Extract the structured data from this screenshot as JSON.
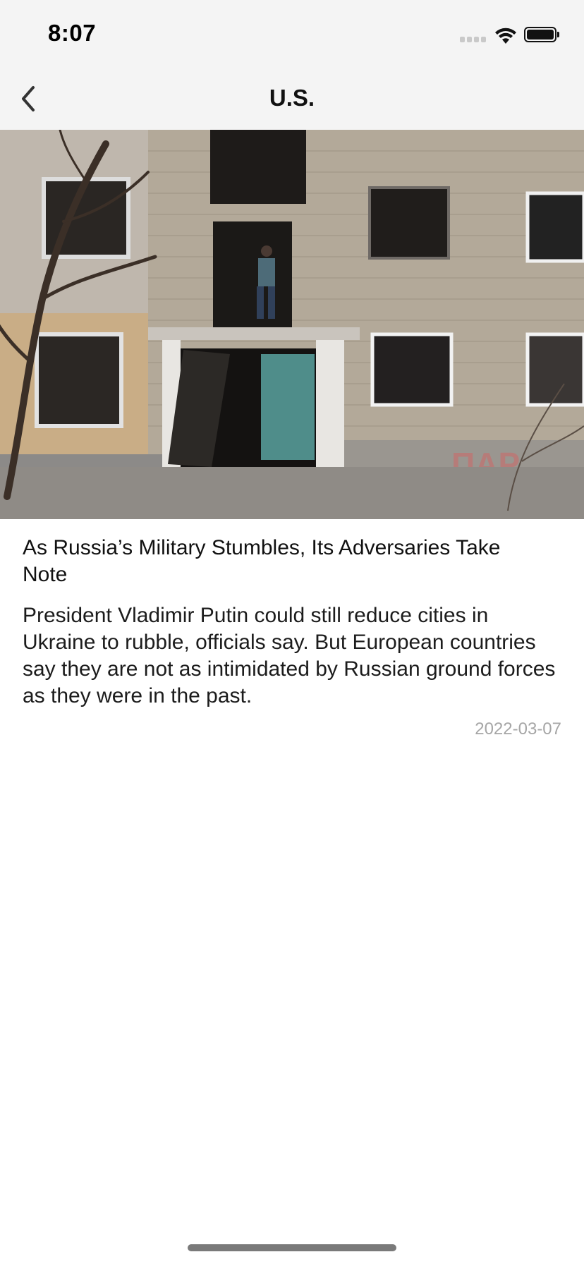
{
  "status_bar": {
    "time": "8:07",
    "icons": [
      "cellular-signal-icon",
      "wifi-icon",
      "battery-icon"
    ]
  },
  "nav_bar": {
    "back_icon": "chevron-left-icon",
    "title": "U.S."
  },
  "article": {
    "image_description_icon": "article-photo",
    "headline": "As Russia’s Military Stumbles, Its Adversaries Take Note",
    "summary": "President Vladimir Putin could still reduce cities in Ukraine to rubble, officials say. But European countries say they are not as intimidated by Russian ground forces as they were in the past.",
    "date": "2022-03-07"
  },
  "colors": {
    "bar_background": "#f4f4f4",
    "date_text": "#a6a6a6",
    "home_indicator": "#7a7a7a"
  }
}
